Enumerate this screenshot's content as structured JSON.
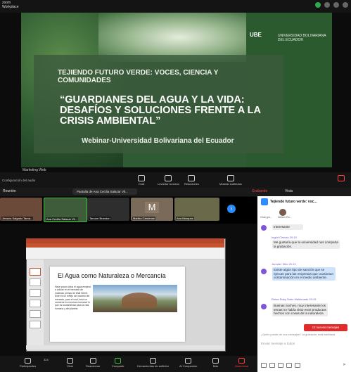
{
  "top_bar": {
    "zoom_logo_line1": "zoom",
    "zoom_logo_line2": "Workplace"
  },
  "shared_slide": {
    "tagline": "TEJIENDO FUTURO VERDE: VOCES, CIENCIA Y COMUNIDADES",
    "title": "“GUARDIANES DEL AGUA Y LA VIDA: DESAFÍOS Y SOLUCIONES FRENTE A LA CRISIS AMBIENTAL”",
    "webinar": "Webinar-Universidad Bolivariana del Ecuador",
    "logo_mark": "UBE",
    "logo_name": "UNIVERSIDAD BOLIVARIANA DEL ECUADOR",
    "presenter_label": "Marketing Web"
  },
  "toolbar_1": {
    "audio_config": "Configuración del audio",
    "items": [
      "Chat",
      "Levantar la mano",
      "Reacciones",
      "Mostrar subtítulos"
    ]
  },
  "header_2": {
    "meeting_label": "Reunión",
    "share_pill": "Pantalla de Ana Cecilia Salazar Vil...",
    "recording": "Grabando",
    "view": "Vista"
  },
  "participants": [
    {
      "name": "Jessica Salgado Tama...",
      "color": "#6b4a3a"
    },
    {
      "name": "Ana Cecilia Salazar Vil...",
      "color": "#3e5b3a"
    },
    {
      "name": "Taroom Brandon",
      "color": "#2e2e2e"
    },
    {
      "name": "Martha Cárdenas",
      "initial": "M",
      "color": "#7a6a5a"
    },
    {
      "name": "Ana Marquez",
      "color": "#6a6a4a"
    }
  ],
  "document": {
    "title": "El  Agua como Naturaleza o Mercancía",
    "body": "Hace pocos años el agua empezó a cotizar en el mercado de materias primas de Wall Street. Este es un reflejo del modelo del mercado, para el cual, todo se convierte en recursos inclusive lo que es fundamental para la vida humana y del planeta"
  },
  "toolbar_2": {
    "items": [
      "Participantes",
      "Chat",
      "Reaccionar",
      "Compartir",
      "Herramientas de anfitrión",
      "AI Companion",
      "Más"
    ],
    "participants_count": "324",
    "leave": "Abandonar"
  },
  "chat": {
    "title": "Tejiendo futuro verde: voc...",
    "header_caption": "Chat gru...",
    "header_caption_2": "Nelson Ro...",
    "messages": [
      {
        "sender": "",
        "time": "",
        "text": "Interesante",
        "style": "grey"
      },
      {
        "sender": "Paulina Cuenca",
        "time": "",
        "text": "Me gustaría que la universidad nos comparta la grabación.",
        "style": "grey",
        "sender_visible": "Ingrid Chavez  20:19"
      },
      {
        "sender": "Jennifer Tello  20:19",
        "time": "",
        "text": "Existe algún tipo de sanción que se ejecute para las empresas que ocasionan contaminación en el medio ambiente.",
        "style": "blue"
      },
      {
        "sender": "Reina Ruby Saler Maldonado  20:19",
        "time": "",
        "text": "Buenas noches, muy interesante los temas no había visto esos productos hechos con cosas de la naturaleza",
        "style": "grey"
      }
    ],
    "new_messages_button": "12 nuevos mensajes",
    "note": "¿Quién puede ver sus mensajes? La grabación está habilitada",
    "input_placeholder": "Enviar mensaje a todos"
  }
}
